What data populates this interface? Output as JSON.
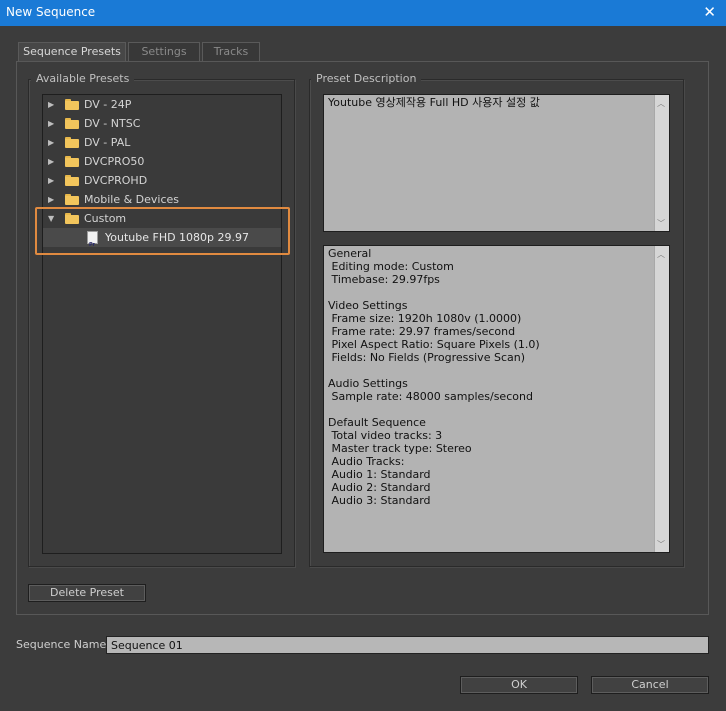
{
  "window": {
    "title": "New Sequence",
    "close_glyph": "✕"
  },
  "tabs": [
    {
      "label": "Sequence Presets",
      "active": true
    },
    {
      "label": "Settings",
      "active": false
    },
    {
      "label": "Tracks",
      "active": false
    }
  ],
  "presets": {
    "group_label": "Available Presets",
    "items": [
      {
        "label": "DV - 24P",
        "icon": "folder-icon",
        "expanded": false
      },
      {
        "label": "DV - NTSC",
        "icon": "folder-icon",
        "expanded": false
      },
      {
        "label": "DV - PAL",
        "icon": "folder-icon",
        "expanded": false
      },
      {
        "label": "DVCPRO50",
        "icon": "folder-icon",
        "expanded": false
      },
      {
        "label": "DVCPROHD",
        "icon": "folder-icon",
        "expanded": false
      },
      {
        "label": "Mobile & Devices",
        "icon": "folder-icon",
        "expanded": false
      },
      {
        "label": "Custom",
        "icon": "folder-icon",
        "expanded": true
      },
      {
        "label": "Youtube FHD 1080p 29.97",
        "icon": "premiere-preset-file-icon",
        "selected": true
      }
    ],
    "delete_button": "Delete Preset"
  },
  "description": {
    "group_label": "Preset Description",
    "text": "Youtube 영상제작용 Full HD 사용자 설정 값",
    "details": [
      "General",
      " Editing mode: Custom",
      " Timebase: 29.97fps",
      "",
      "Video Settings",
      " Frame size: 1920h 1080v (1.0000)",
      " Frame rate: 29.97 frames/second",
      " Pixel Aspect Ratio: Square Pixels (1.0)",
      " Fields: No Fields (Progressive Scan)",
      "",
      "Audio Settings",
      " Sample rate: 48000 samples/second",
      "",
      "Default Sequence",
      " Total video tracks: 3",
      " Master track type: Stereo",
      " Audio Tracks:",
      " Audio 1: Standard",
      " Audio 2: Standard",
      " Audio 3: Standard"
    ]
  },
  "sequence_name": {
    "label": "Sequence Name:",
    "value": "Sequence 01"
  },
  "buttons": {
    "ok": "OK",
    "cancel": "Cancel"
  },
  "colors": {
    "titlebar": "#1a7ad6",
    "highlight": "#e08a40",
    "folder": "#f2c55c"
  }
}
